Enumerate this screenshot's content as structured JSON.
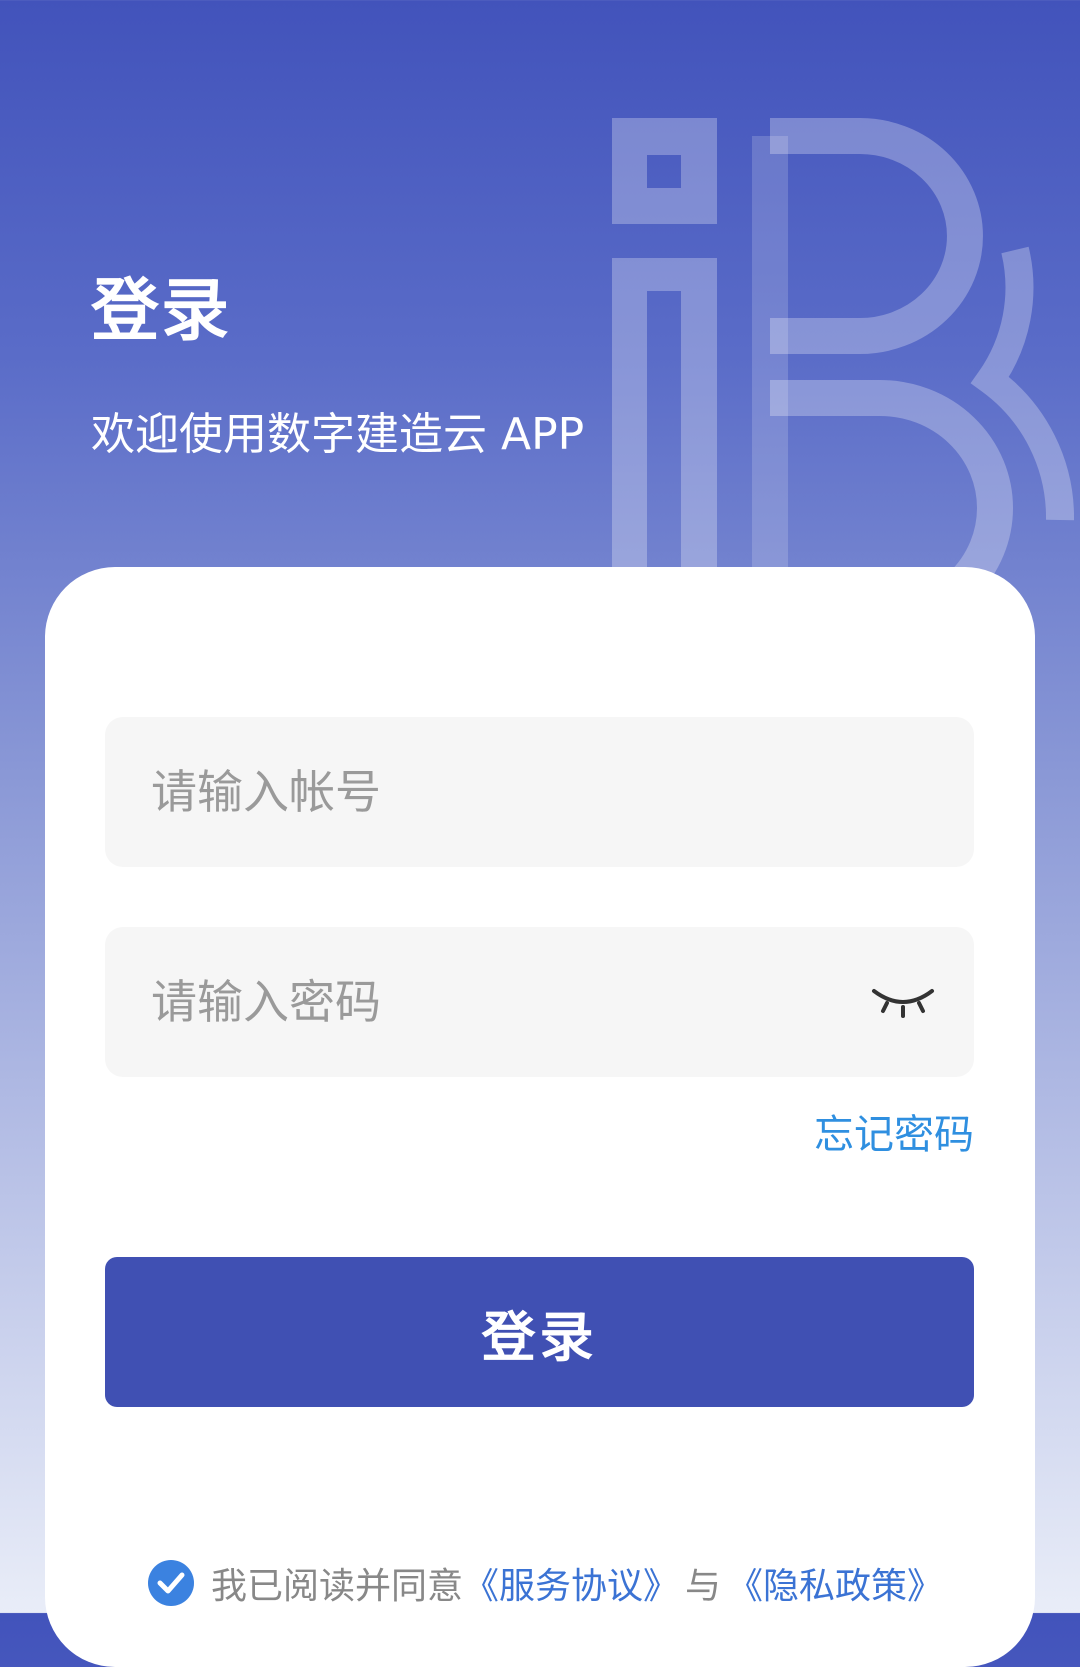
{
  "header": {
    "title": "登录",
    "subtitle": "欢迎使用数字建造云 APP"
  },
  "form": {
    "account_placeholder": "请输入帐号",
    "password_placeholder": "请输入密码",
    "password_toggle_icon": "eye-closed-icon",
    "forgot_password": "忘记密码"
  },
  "actions": {
    "login_label": "登录"
  },
  "agreement": {
    "checked": true,
    "prefix": "我已阅读并同意",
    "service_link": "《服务协议》",
    "separator": "与",
    "privacy_link": "《隐私政策》"
  },
  "colors": {
    "primary": "#4050b3",
    "link": "#2f8fe0",
    "field_bg": "#f6f6f6"
  }
}
